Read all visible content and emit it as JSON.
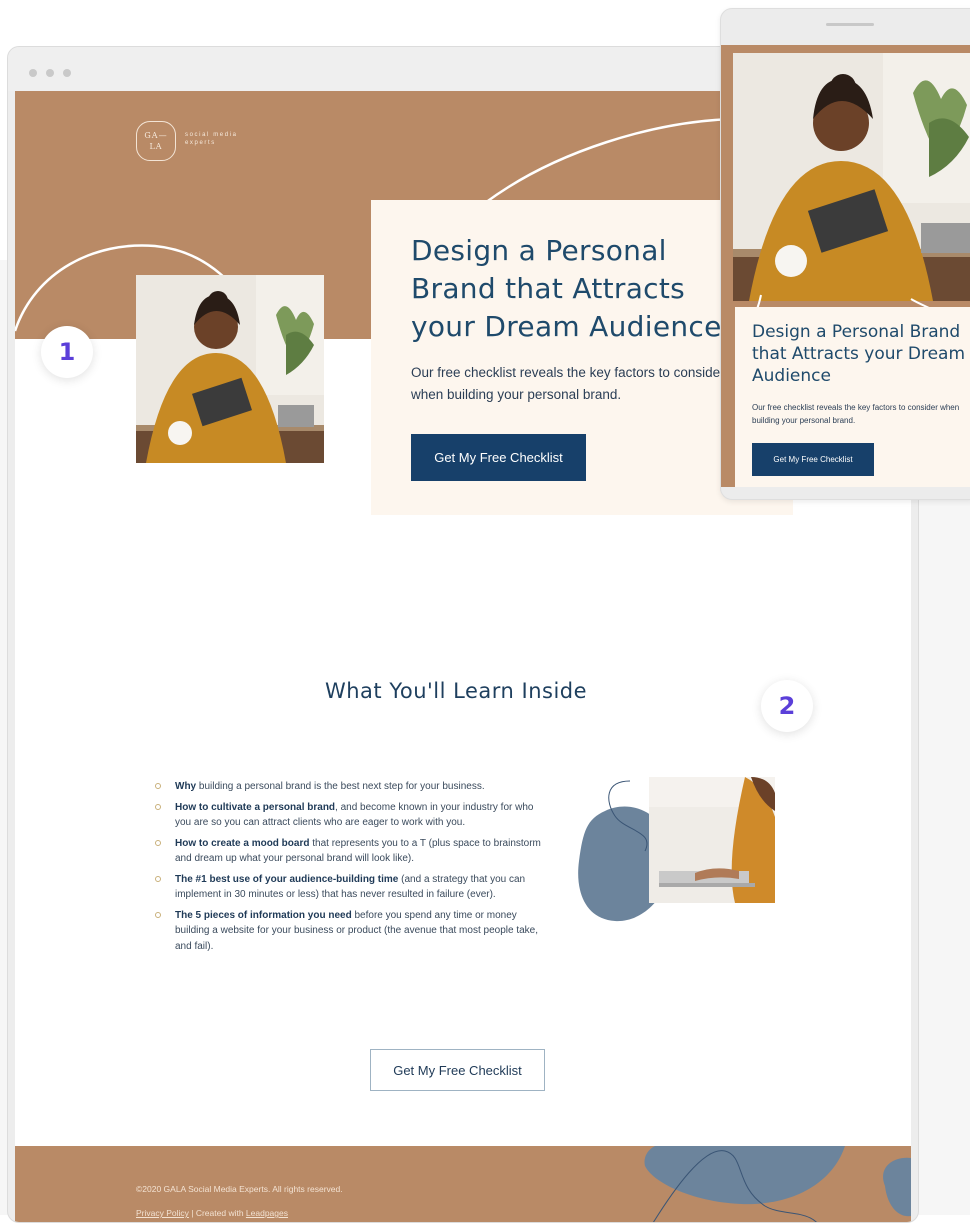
{
  "brand": {
    "logo_mark": "GA— LA",
    "logo_text": "social media experts"
  },
  "hero": {
    "title": "Design a Personal Brand that Attracts your Dream Audience",
    "subtitle": "Our free checklist reveals the key factors to consider when building your personal brand.",
    "cta_label": "Get My Free Checklist"
  },
  "learn": {
    "title": "What You'll Learn Inside",
    "items": [
      {
        "bold": "Why",
        "text": " building a personal brand is the best next step for your business."
      },
      {
        "bold": "How to cultivate a personal brand",
        "text": ", and become known in your industry for who you are so you can attract clients who are eager to work with you."
      },
      {
        "bold": "How to create a mood board",
        "text": " that represents you to a T (plus space to brainstorm and dream up what your personal brand will look like)."
      },
      {
        "bold": "The #1 best use of your audience-building time",
        "text": " (and a strategy that you can implement in 30 minutes or less) that has never resulted in failure (ever)."
      },
      {
        "bold": "The 5 pieces of information you need",
        "text": " before you spend any time or money building a website for your business or product (the avenue that most people take, and fail)."
      }
    ],
    "cta_label": "Get My Free Checklist"
  },
  "footer": {
    "copyright": "©2020 GALA Social Media Experts. All rights reserved.",
    "privacy_label": "Privacy Policy",
    "separator": " | Created with ",
    "leadpages_label": "Leadpages"
  },
  "mobile": {
    "title": "Design a Personal Brand that Attracts your Dream Audience",
    "subtitle": "Our free checklist reveals the key factors to consider when building your personal brand.",
    "cta_label": "Get My Free Checklist"
  },
  "markers": {
    "one": "1",
    "two": "2"
  },
  "colors": {
    "tan": "#b98a66",
    "navy": "#17406a",
    "cream": "#fdf6ee",
    "slate_blue": "#6c849c",
    "marker_purple": "#5b3fd9"
  },
  "icons": [
    "browser-dot-icon",
    "bullet-circle-icon"
  ]
}
